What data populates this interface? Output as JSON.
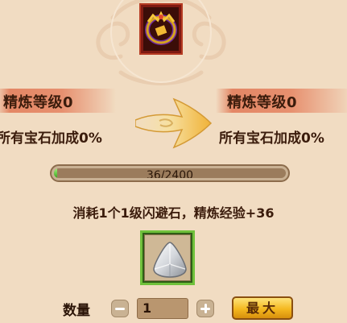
{
  "item": {
    "icon": "gold-purple-ring-icon"
  },
  "current": {
    "level_text": "精炼等级0",
    "bonus_text": "所有宝石加成0%"
  },
  "next": {
    "level_text": "精炼等级0",
    "bonus_text": "所有宝石加成0%"
  },
  "exp": {
    "text": "36/2400",
    "fraction": 0.015
  },
  "consume_text": "消耗1个1级闪避石，精炼经验+36",
  "gem": {
    "icon": "silver-gem-icon"
  },
  "quantity": {
    "label": "数量",
    "value": "1"
  },
  "buttons": {
    "max_label": "最大",
    "minus_icon": "minus-icon",
    "plus_icon": "plus-icon"
  },
  "colors": {
    "banner": "#e7906f",
    "exp_fill": "#3aa31e",
    "gem_border": "#6fc13b",
    "max_button": "#f4b81f"
  }
}
